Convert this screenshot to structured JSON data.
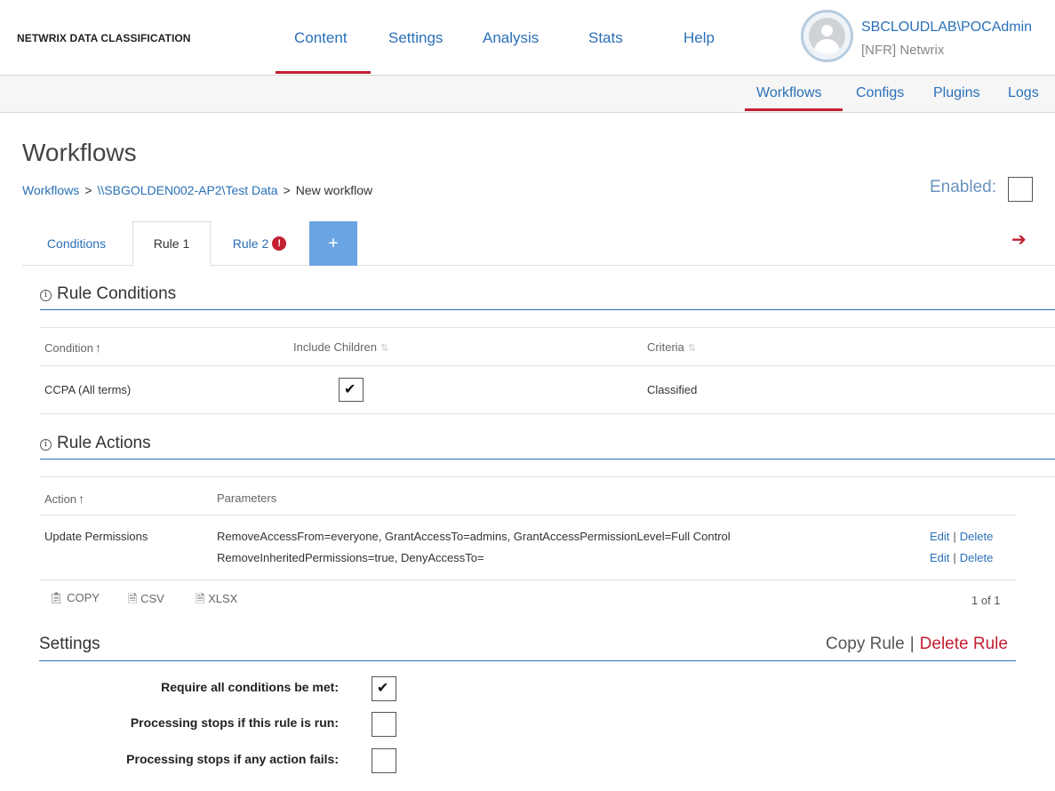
{
  "app": {
    "brand": "NETWRIX DATA CLASSIFICATION"
  },
  "main_nav": [
    {
      "label": "Content",
      "active": true
    },
    {
      "label": "Settings"
    },
    {
      "label": "Analysis"
    },
    {
      "label": "Stats"
    },
    {
      "label": "Help"
    }
  ],
  "user": {
    "name": "SBCLOUDLAB\\POCAdmin",
    "org": "[NFR] Netwrix"
  },
  "sub_nav": [
    {
      "label": "Workflows",
      "active": true
    },
    {
      "label": "Configs"
    },
    {
      "label": "Plugins"
    },
    {
      "label": "Logs"
    }
  ],
  "page": {
    "title": "Workflows",
    "breadcrumb": [
      "Workflows",
      "\\\\SBGOLDEN002-AP2\\Test Data",
      "New workflow"
    ],
    "breadcrumb_sep": ">",
    "enabled_label": "Enabled:",
    "enabled": false
  },
  "tabs": [
    {
      "label": "Conditions"
    },
    {
      "label": "Rule 1",
      "active": true
    },
    {
      "label": "Rule 2",
      "error": true,
      "error_glyph": "!"
    },
    {
      "label": "+"
    }
  ],
  "rule_conditions": {
    "title": "Rule Conditions",
    "columns": [
      "Condition",
      "Include Children",
      "Criteria"
    ],
    "rows": [
      {
        "condition": "CCPA (All terms)",
        "include_children": true,
        "criteria": "Classified"
      }
    ]
  },
  "rule_actions": {
    "title": "Rule Actions",
    "columns": [
      "Action",
      "Parameters"
    ],
    "rows": [
      {
        "action": "Update Permissions",
        "parameters": [
          "RemoveAccessFrom=everyone, GrantAccessTo=admins, GrantAccessPermissionLevel=Full Control",
          "RemoveInheritedPermissions=true, DenyAccessTo="
        ],
        "edit_label": "Edit",
        "delete_label": "Delete",
        "link_sep": "|"
      }
    ],
    "export": {
      "copy": "COPY",
      "csv": "CSV",
      "xlsx": "XLSX"
    },
    "pager": "1 of 1"
  },
  "settings": {
    "title": "Settings",
    "copy_rule": "Copy Rule",
    "delete_rule": "Delete Rule",
    "sep": "|",
    "options": [
      {
        "label": "Require all conditions be met:",
        "checked": true
      },
      {
        "label": "Processing stops if this rule is run:",
        "checked": false
      },
      {
        "label": "Processing stops if any action fails:",
        "checked": false
      }
    ]
  },
  "icons": {
    "info": "info-icon",
    "sort_asc": "arrow-up-icon",
    "sort_both": "sort-icon",
    "next": "arrow-right-icon",
    "copy": "clipboard-icon",
    "csv": "csv-file-icon",
    "xlsx": "xlsx-file-icon",
    "error": "error-badge-icon",
    "avatar": "user-avatar-icon"
  },
  "colors": {
    "link": "#2a70b8",
    "accent_red": "#c21f32",
    "tab_plus": "#6aa4e3"
  }
}
